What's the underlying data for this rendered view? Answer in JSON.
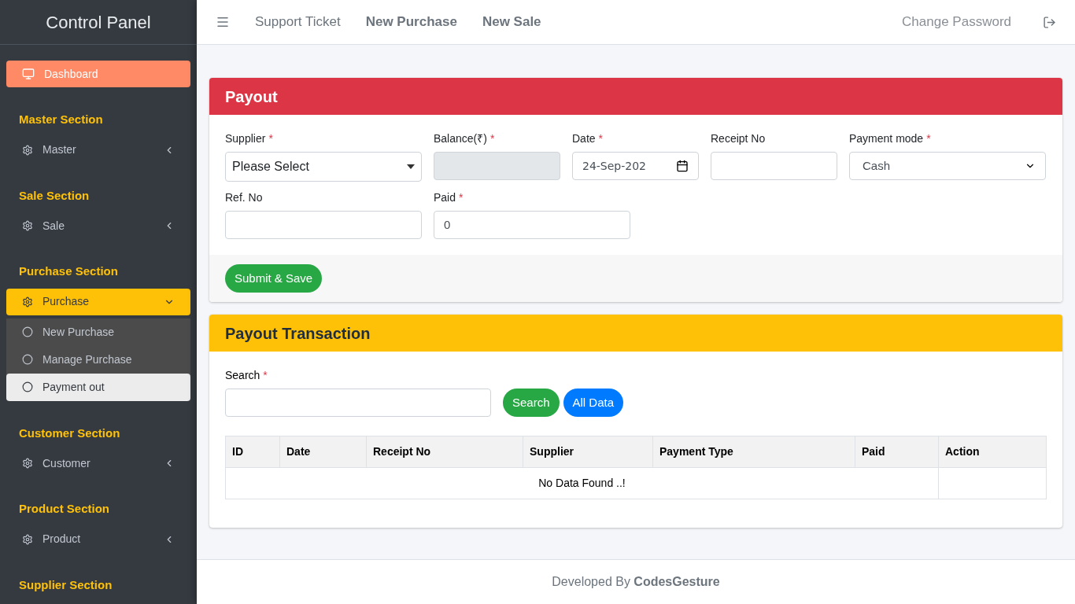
{
  "sidebar": {
    "title": "Control Panel",
    "items": [
      {
        "kind": "link",
        "label": "Dashboard",
        "selected": true
      },
      {
        "kind": "header",
        "label": "Master Section"
      },
      {
        "kind": "menu",
        "label": "Master",
        "expanded": false
      },
      {
        "kind": "header",
        "label": "Sale Section"
      },
      {
        "kind": "menu",
        "label": "Sale",
        "expanded": false
      },
      {
        "kind": "header",
        "label": "Purchase Section"
      },
      {
        "kind": "menu",
        "label": "Purchase",
        "expanded": true,
        "children": [
          {
            "label": "New Purchase",
            "selected": false
          },
          {
            "label": "Manage Purchase",
            "selected": false
          },
          {
            "label": "Payment out",
            "selected": true
          }
        ]
      },
      {
        "kind": "header",
        "label": "Customer Section"
      },
      {
        "kind": "menu",
        "label": "Customer",
        "expanded": false
      },
      {
        "kind": "header",
        "label": "Product Section"
      },
      {
        "kind": "menu",
        "label": "Product",
        "expanded": false
      },
      {
        "kind": "header",
        "label": "Supplier Section"
      }
    ]
  },
  "topbar": {
    "links": [
      {
        "label": "Support Ticket",
        "emphasis": false
      },
      {
        "label": "New Purchase",
        "emphasis": true
      },
      {
        "label": "New Sale",
        "emphasis": true
      }
    ],
    "right_link": "Change Password"
  },
  "payout": {
    "title": "Payout",
    "fields": [
      {
        "kind": "select",
        "label": "Supplier",
        "required_mark": "*",
        "value": "Please Select"
      },
      {
        "kind": "input",
        "label": "Balance(₹)",
        "required_mark": "*",
        "disabled": true
      },
      {
        "kind": "date",
        "label": "Date",
        "required_mark": "*",
        "value": "24-Sep-202"
      },
      {
        "kind": "input",
        "label": "Receipt No",
        "disabled": false
      },
      {
        "kind": "dropdown",
        "label": "Payment mode",
        "required_mark": "*",
        "value": "Cash"
      },
      {
        "kind": "input",
        "label": "Ref. No",
        "disabled": false
      },
      {
        "kind": "input",
        "label": "Paid",
        "required_mark": "*",
        "value": "0",
        "disabled": false
      }
    ],
    "submit": "Submit & Save"
  },
  "transactions": {
    "title": "Payout Transaction",
    "search_label": "Search",
    "search_mark": "*",
    "buttons": [
      "Search",
      "All Data"
    ],
    "table": {
      "columns": [
        "ID",
        "Date",
        "Receipt No",
        "Supplier",
        "Payment Type",
        "Paid",
        "Action"
      ],
      "empty_message": "No Data Found ..!"
    }
  },
  "footer": "Developed By **CodesGesture**"
}
